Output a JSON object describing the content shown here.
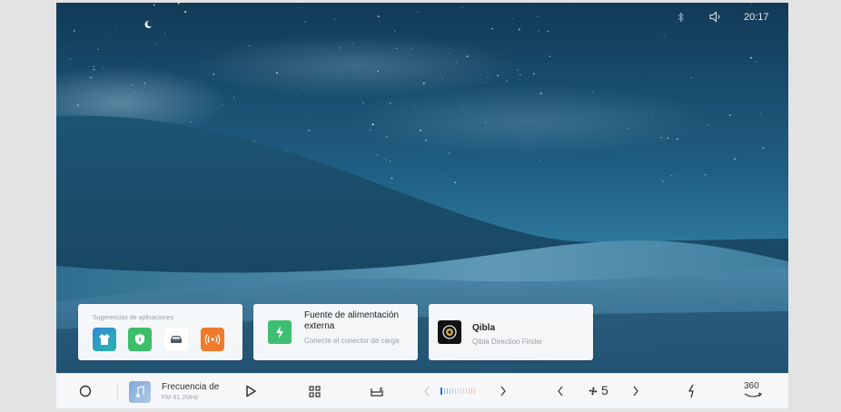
{
  "status": {
    "time": "20:17",
    "icons": [
      "bluetooth-icon",
      "volume-icon"
    ]
  },
  "wallpaper": {
    "icons": [
      "moon-icon"
    ]
  },
  "cards": {
    "suggestions": {
      "title": "Sugerencias de aplicaciones",
      "apps": [
        "shirt-app-icon",
        "shield-app-icon",
        "car-app-icon",
        "hotspot-app-icon"
      ]
    },
    "power": {
      "title": "Fuente de alimentación externa",
      "subtitle": "Conecte el conector de carga",
      "icon": "lightning-icon",
      "color": "#3dbf73"
    },
    "qibla": {
      "title": "Qibla",
      "subtitle": "Qibla Direction Finder",
      "icon": "compass-icon"
    }
  },
  "dock": {
    "home_icon": "home-circle-icon",
    "media": {
      "title": "Frecuencia de",
      "subtitle": "FM-91.2MHz",
      "icon": "music-note-icon"
    },
    "play_icon": "play-icon",
    "apps_icon": "app-grid-icon",
    "seat_icon": "seat-icon",
    "temperature": {
      "icons": [
        "chevron-left-icon",
        "chevron-right-icon"
      ]
    },
    "fan": {
      "value": "5",
      "icons": [
        "chevron-left-icon",
        "fan-icon",
        "chevron-right-icon"
      ]
    },
    "charge_icon": "lightning-icon",
    "camera_label": "360"
  }
}
